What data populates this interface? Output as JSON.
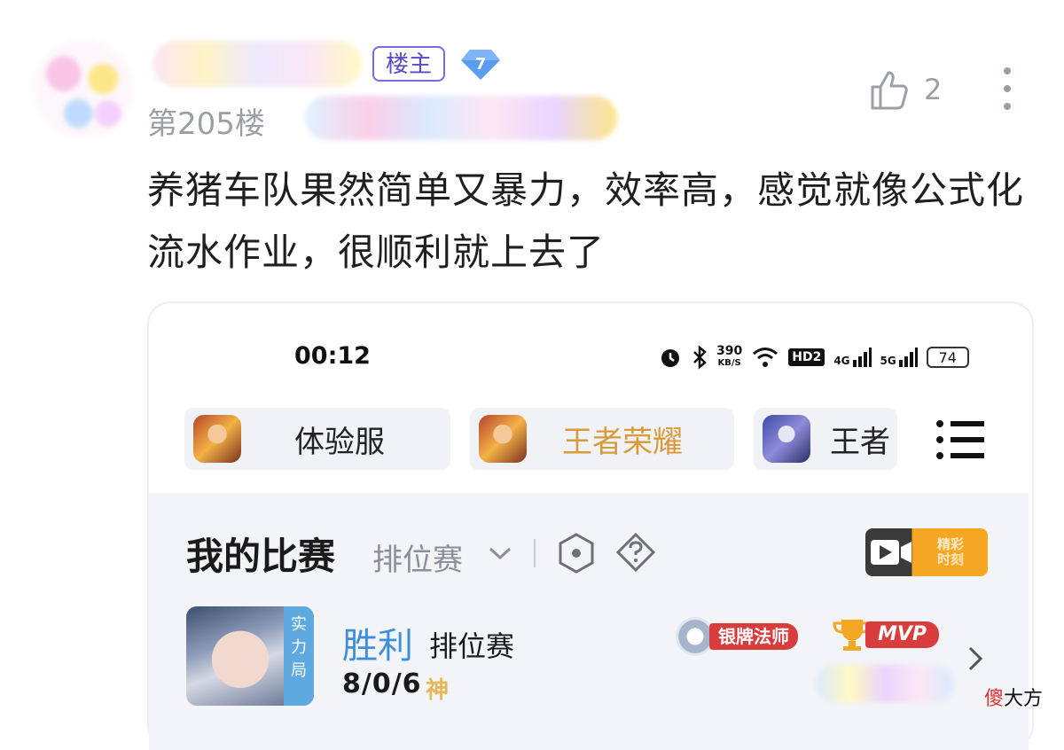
{
  "post": {
    "host_badge": "楼主",
    "level": "7",
    "floor": "第205楼",
    "like_count": "2",
    "content": "养猪车队果然简单又暴力，效率高，感觉就像公式化流水作业，很顺利就上去了"
  },
  "screenshot": {
    "status_bar": {
      "time": "00:12",
      "speed_value": "390",
      "speed_unit": "KB/S",
      "hd_badge": "HD2",
      "net1": "4G",
      "net2": "5G",
      "battery": "74"
    },
    "game_tabs": [
      {
        "label": "体验服",
        "color": "#222222"
      },
      {
        "label": "王者荣耀",
        "color": "#d99a3a"
      },
      {
        "label": "王者",
        "color": "#222222"
      }
    ],
    "section": {
      "title": "我的比赛",
      "mode_selector": "排位赛",
      "highlight_btn": "精彩时刻"
    },
    "match": {
      "hero_tag": "实力局",
      "result": "胜利",
      "mode": "排位赛",
      "kda": "8/0/6",
      "grade": "神",
      "title_badge": "银牌法师",
      "mvp_badge": "MVP"
    }
  },
  "watermark": {
    "part1": "傻",
    "part2": "大方"
  }
}
